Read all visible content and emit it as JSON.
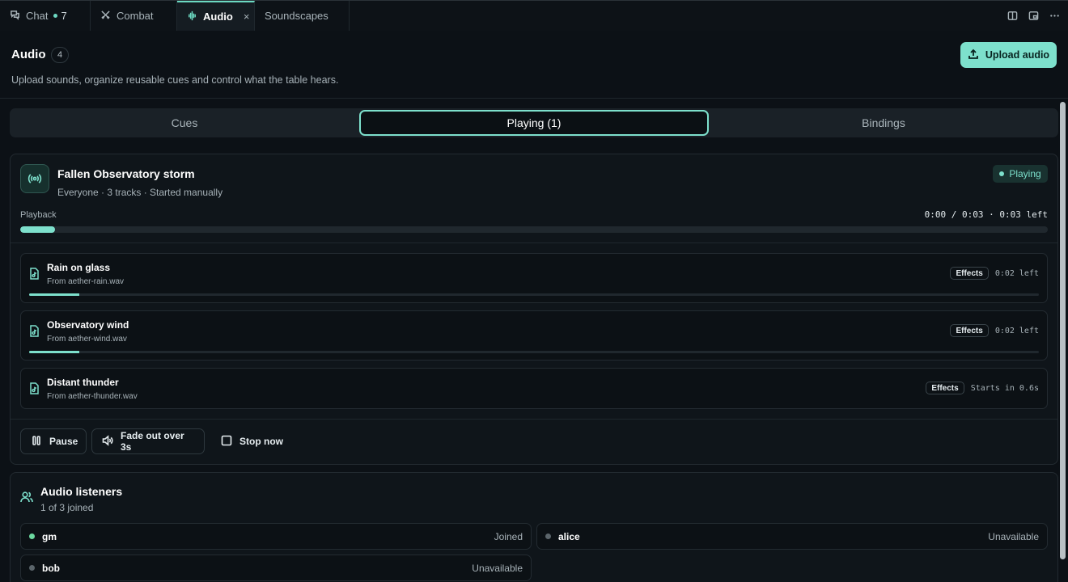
{
  "tabs": [
    {
      "label": "Chat",
      "badge": "7",
      "icon": "chat-icon"
    },
    {
      "label": "Combat",
      "icon": "swords-icon"
    },
    {
      "label": "Audio",
      "icon": "waveform-icon",
      "close": "×",
      "active": true
    },
    {
      "label": "Soundscapes"
    }
  ],
  "header": {
    "title": "Audio",
    "count": "4",
    "subtitle": "Upload sounds, organize reusable cues and control what the table hears.",
    "upload_label": "Upload audio"
  },
  "segments": {
    "cues": "Cues",
    "playing": "Playing (1)",
    "bindings": "Bindings",
    "selected": "playing"
  },
  "playing": {
    "name": "Fallen Observatory storm",
    "meta": "Everyone · 3 tracks · Started manually",
    "status": "Playing",
    "playback_label": "Playback",
    "time": "0:00 / 0:03 · 0:03 left",
    "progress": 0.034,
    "tracks": [
      {
        "name": "Rain on glass",
        "source": "From aether-rain.wav",
        "effects": "Effects",
        "status": "0:02 left",
        "progress": 0.05
      },
      {
        "name": "Observatory wind",
        "source": "From aether-wind.wav",
        "effects": "Effects",
        "status": "0:02 left",
        "progress": 0.05
      },
      {
        "name": "Distant thunder",
        "source": "From aether-thunder.wav",
        "effects": "Effects",
        "status": "Starts in 0.6s"
      }
    ],
    "actions": {
      "pause": "Pause",
      "fade": "Fade out over 3s",
      "stop": "Stop now"
    }
  },
  "listeners": {
    "title": "Audio listeners",
    "subtitle": "1 of 3 joined",
    "users": [
      {
        "name": "gm",
        "state": "Joined",
        "online": true
      },
      {
        "name": "alice",
        "state": "Unavailable",
        "online": false
      },
      {
        "name": "bob",
        "state": "Unavailable",
        "online": false
      }
    ]
  },
  "colors": {
    "accent": "#7de0cc",
    "background": "#0c1116",
    "card": "#0f151a"
  }
}
